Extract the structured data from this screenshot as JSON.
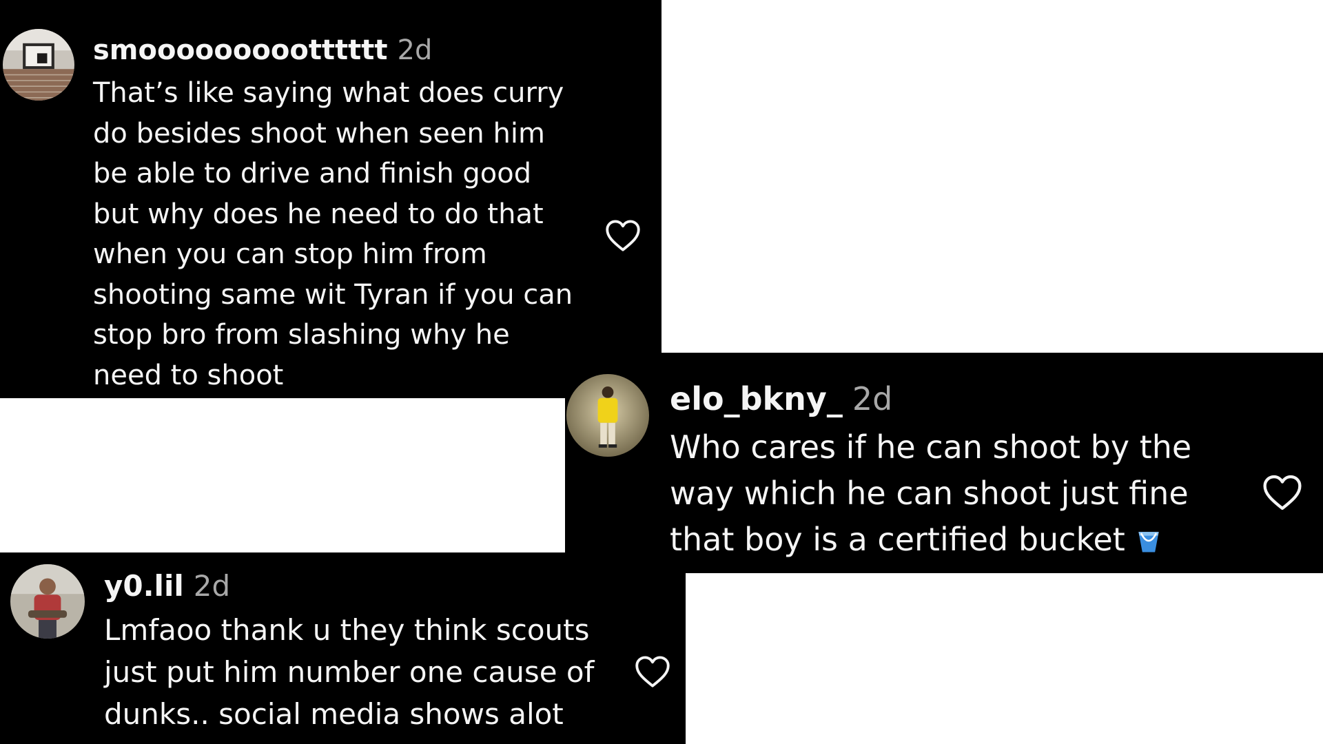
{
  "colors": {
    "card_background": "#000000",
    "page_background": "#ffffff",
    "text_primary": "#f5f5f5",
    "text_secondary": "#a8a8a8",
    "bucket_emoji": "#3a8ee0"
  },
  "comments": [
    {
      "username": "smoooooooootttttt",
      "time": "2d",
      "text": "That’s like saying what does curry\ndo besides shoot when seen him\nbe able to drive and finish good\nbut why does he need to do that\nwhen you can stop him from\nshooting same wit Tyran if you can\nstop bro from slashing why he\nneed to shoot",
      "avatar_icon": "avatar-brick-window",
      "like_icon": "heart-outline-icon"
    },
    {
      "username": "elo_bkny_",
      "time": "2d",
      "text": "Who cares if he can shoot by the\nway which he can shoot just fine\nthat boy is a certified bucket",
      "emoji_icon": "bucket-emoji",
      "avatar_icon": "avatar-person-yellow",
      "like_icon": "heart-outline-icon"
    },
    {
      "username": "y0.lil",
      "time": "2d",
      "text": "Lmfaoo thank u they think scouts\njust put him number one cause of\ndunks.. social media shows alot",
      "avatar_icon": "avatar-person-red",
      "like_icon": "heart-outline-icon"
    }
  ]
}
